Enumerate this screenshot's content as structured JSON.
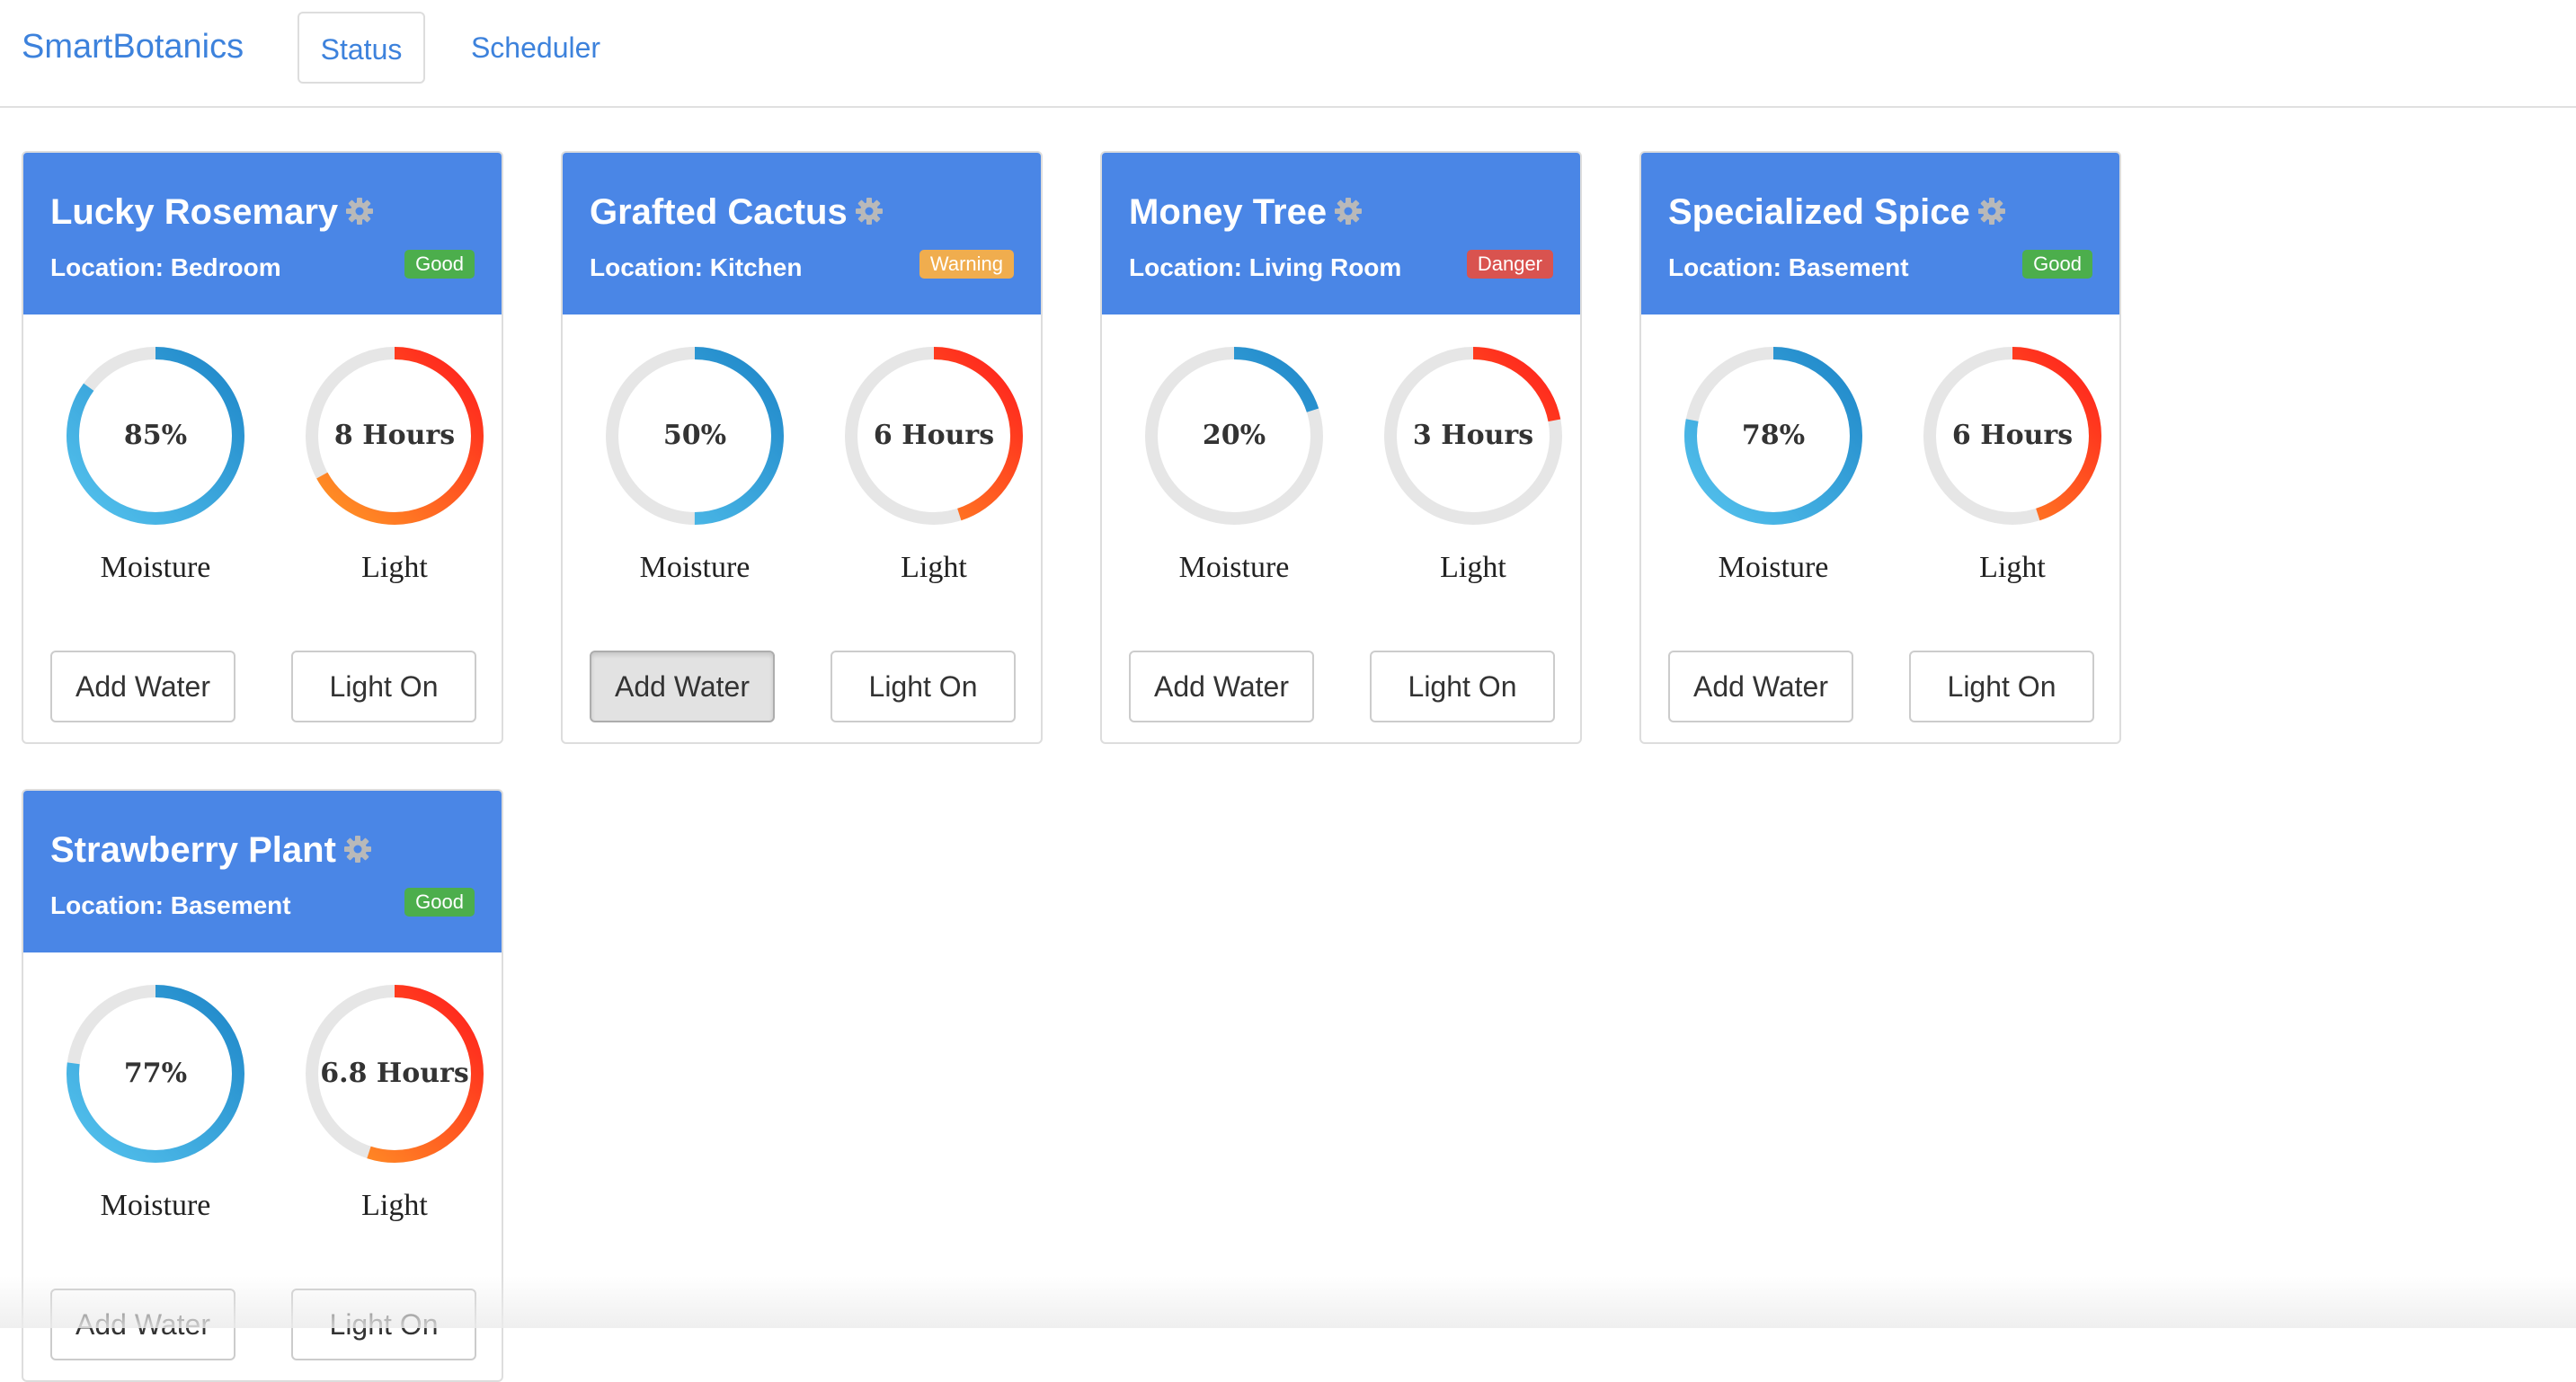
{
  "app": {
    "brand": "SmartBotanics",
    "tabs": [
      {
        "label": "Status",
        "active": true
      },
      {
        "label": "Scheduler",
        "active": false
      }
    ]
  },
  "colors": {
    "header_bg": "#4a86e6",
    "brand": "#3d82dc",
    "badge_good": "#4cae4c",
    "badge_warning": "#f0ad4e",
    "badge_danger": "#d9534f",
    "moisture_start": "#55c3ee",
    "moisture_end": "#1e86c8",
    "light_start": "#ff9a26",
    "light_end": "#ff1c1c",
    "track": "#e6e6e6"
  },
  "plants": [
    {
      "name": "Lucky Rosemary",
      "location": "Location: Bedroom",
      "status": "Good",
      "status_type": "good",
      "moisture": {
        "value": "85%",
        "fraction": 0.85,
        "label": "Moisture"
      },
      "light": {
        "value": "8 Hours",
        "fraction": 0.67,
        "label": "Light"
      },
      "water_button": "Add Water",
      "light_button": "Light On",
      "water_pressed": false
    },
    {
      "name": "Grafted Cactus",
      "location": "Location: Kitchen",
      "status": "Warning",
      "status_type": "warning",
      "moisture": {
        "value": "50%",
        "fraction": 0.5,
        "label": "Moisture"
      },
      "light": {
        "value": "6 Hours",
        "fraction": 0.45,
        "label": "Light"
      },
      "water_button": "Add Water",
      "light_button": "Light On",
      "water_pressed": true
    },
    {
      "name": "Money Tree",
      "location": "Location: Living Room",
      "status": "Danger",
      "status_type": "danger",
      "moisture": {
        "value": "20%",
        "fraction": 0.2,
        "label": "Moisture"
      },
      "light": {
        "value": "3 Hours",
        "fraction": 0.22,
        "label": "Light"
      },
      "water_button": "Add Water",
      "light_button": "Light On",
      "water_pressed": false
    },
    {
      "name": "Specialized Spice",
      "location": "Location: Basement",
      "status": "Good",
      "status_type": "good",
      "moisture": {
        "value": "78%",
        "fraction": 0.78,
        "label": "Moisture"
      },
      "light": {
        "value": "6 Hours",
        "fraction": 0.45,
        "label": "Light"
      },
      "water_button": "Add Water",
      "light_button": "Light On",
      "water_pressed": false
    },
    {
      "name": "Strawberry Plant",
      "location": "Location: Basement",
      "status": "Good",
      "status_type": "good",
      "moisture": {
        "value": "77%",
        "fraction": 0.77,
        "label": "Moisture"
      },
      "light": {
        "value": "6.8 Hours",
        "fraction": 0.55,
        "label": "Light"
      },
      "water_button": "Add Water",
      "light_button": "Light On",
      "water_pressed": false
    }
  ]
}
